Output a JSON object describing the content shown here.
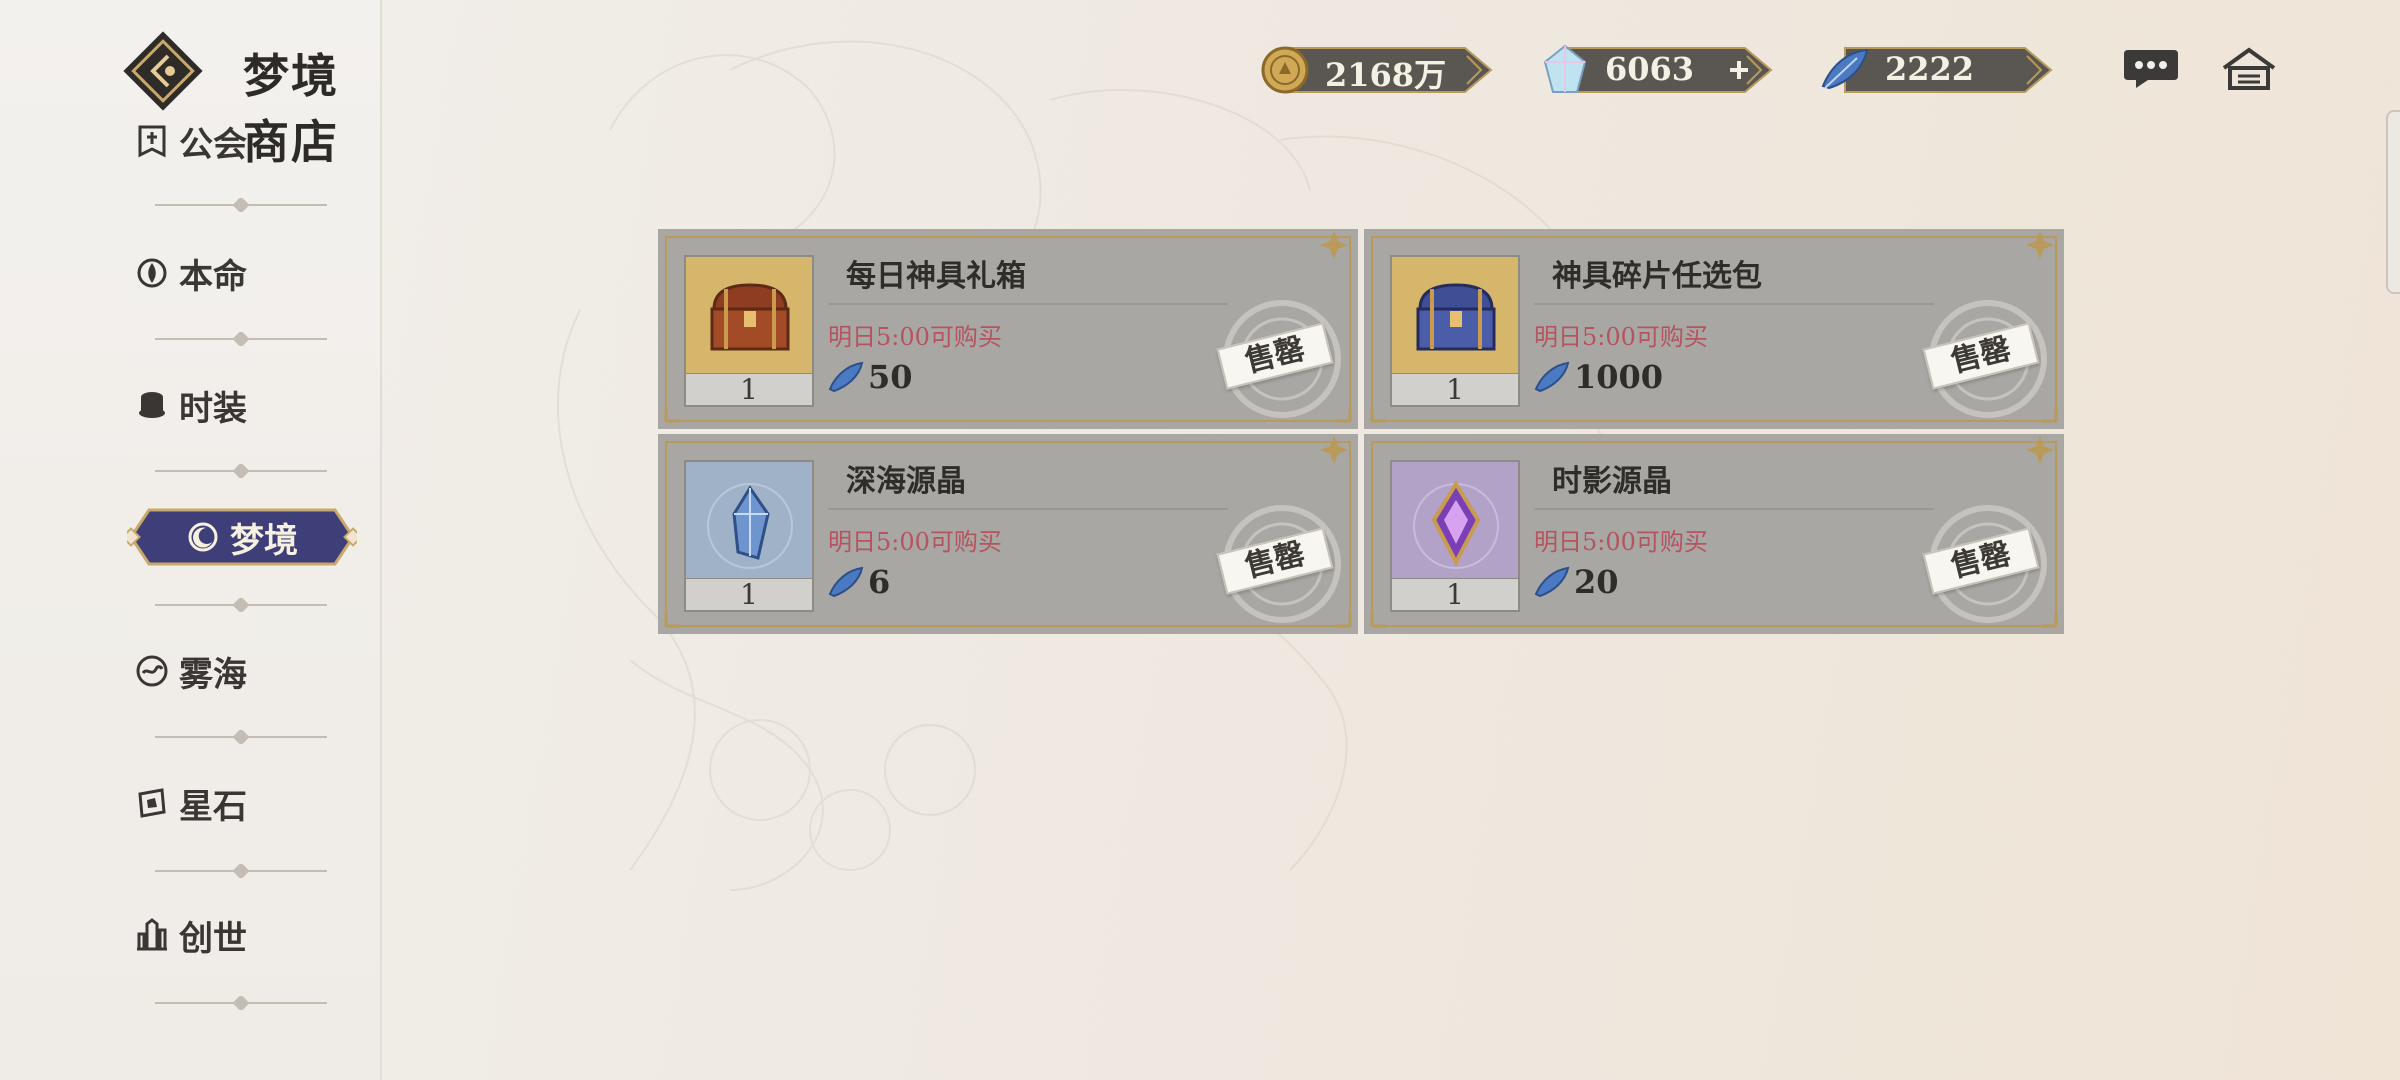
{
  "header": {
    "title": "梦境商店"
  },
  "currencies": [
    {
      "name": "gold",
      "value": "2168万",
      "icon": "gold-coin-icon"
    },
    {
      "name": "diamond",
      "value": "6063",
      "icon": "crystal-gem-icon",
      "has_add": true
    },
    {
      "name": "dream-feather",
      "value": "2222",
      "icon": "blue-feather-icon"
    }
  ],
  "top_icons": [
    "chat-bubble-icon",
    "home-icon"
  ],
  "sidebar": {
    "items": [
      {
        "label": "公会",
        "icon": "guild-banner-icon"
      },
      {
        "label": "本命",
        "icon": "lotus-emblem-icon"
      },
      {
        "label": "时装",
        "icon": "hat-icon"
      },
      {
        "label": "梦境",
        "icon": "moon-star-icon",
        "active": true
      },
      {
        "label": "雾海",
        "icon": "mist-sea-icon"
      },
      {
        "label": "星石",
        "icon": "star-stone-icon"
      },
      {
        "label": "创世",
        "icon": "castle-icon"
      }
    ]
  },
  "shop": {
    "items": [
      {
        "name": "每日神具礼箱",
        "restock": "明日5:00可购买",
        "price": "50",
        "qty": "1",
        "status": "售罄",
        "thumb_color": "#d6b66a",
        "art": "treasure-chest-red-icon"
      },
      {
        "name": "神具碎片任选包",
        "restock": "明日5:00可购买",
        "price": "1000",
        "qty": "1",
        "status": "售罄",
        "thumb_color": "#d6b66a",
        "art": "treasure-chest-blue-icon"
      },
      {
        "name": "深海源晶",
        "restock": "明日5:00可购买",
        "price": "6",
        "qty": "1",
        "status": "售罄",
        "thumb_color": "#9fb2c8",
        "art": "blue-crystal-icon"
      },
      {
        "name": "时影源晶",
        "restock": "明日5:00可购买",
        "price": "20",
        "qty": "1",
        "status": "售罄",
        "thumb_color": "#b3a2c7",
        "art": "purple-crystal-icon"
      }
    ]
  },
  "colors": {
    "accent_gold": "#b99a5a",
    "nav_active": "#3e3f78",
    "restock_red": "#b5545e",
    "card_bg": "#a9a7a4"
  }
}
